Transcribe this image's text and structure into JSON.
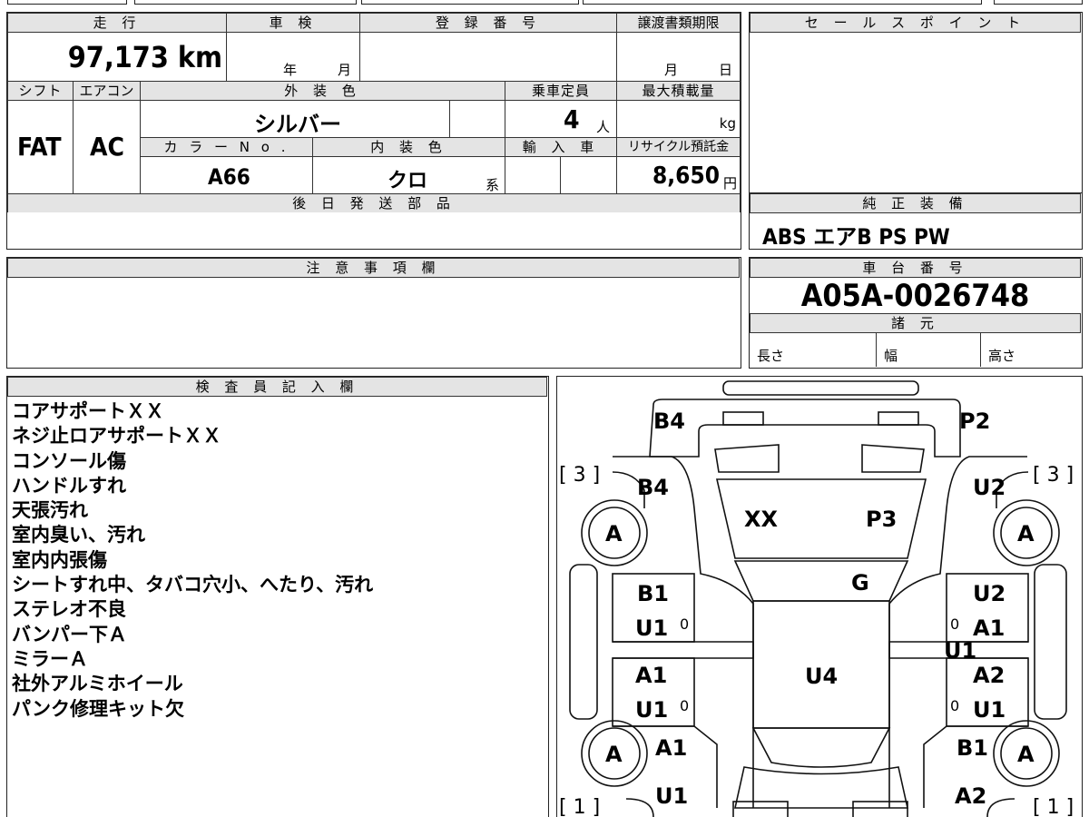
{
  "vehicle_info": {
    "mileage_label": "走 行",
    "mileage_value": "97,173 km",
    "inspection_label": "車 検",
    "inspection_year": "年",
    "inspection_month": "月",
    "registration_label": "登 録 番 号",
    "transfer_deadline_label": "譲渡書類期限",
    "transfer_month": "月",
    "transfer_day": "日",
    "shift_label": "シフト",
    "shift_value": "FAT",
    "aircon_label": "エアコン",
    "aircon_value": "AC",
    "exterior_color_label": "外 装 色",
    "exterior_color_value": "シルバー",
    "capacity_label": "乗車定員",
    "capacity_value": "4",
    "capacity_unit": "人",
    "max_load_label": "最大積載量",
    "max_load_unit": "kg",
    "color_no_label": "カ ラ ー N o .",
    "color_no_value": "A66",
    "interior_color_label": "内 装 色",
    "interior_color_value": "クロ",
    "interior_color_suffix": "系",
    "import_label": "輸 入 車",
    "recycle_label": "リサイクル預託金",
    "recycle_value": "8,650",
    "recycle_unit": "円",
    "later_parts_label": "後 日 発 送 部 品"
  },
  "sales_point": {
    "label": "セ ー ル ス ポ イ ン ト"
  },
  "standard_equipment": {
    "label": "純 正 装 備",
    "value": "ABS エアB PS PW"
  },
  "notes": {
    "label": "注 意 事 項 欄"
  },
  "chassis": {
    "label": "車 台 番 号",
    "value": "A05A-0026748",
    "specs_label": "諸 元",
    "length_label": "長さ",
    "width_label": "幅",
    "height_label": "高さ"
  },
  "inspector": {
    "label": "検 査 員 記 入 欄",
    "remarks": [
      "コアサポートＸＸ",
      "ネジ止ロアサポートＸＸ",
      "コンソール傷",
      "ハンドルすれ",
      "天張汚れ",
      "室内臭い、汚れ",
      "室内内張傷",
      "シートすれ中、タバコ穴小、へたり、汚れ",
      "ステレオ不良",
      "バンパー下Ａ",
      "ミラーＡ",
      "社外アルミホイール",
      "パンク修理キット欠"
    ]
  },
  "diagram": {
    "marks": [
      {
        "text": "B4"
      },
      {
        "text": "P2"
      },
      {
        "text": "B4"
      },
      {
        "text": "U2"
      },
      {
        "text": "XX"
      },
      {
        "text": "P3"
      },
      {
        "text": "G"
      },
      {
        "text": "B1"
      },
      {
        "text": "U1"
      },
      {
        "text": "U2"
      },
      {
        "text": "A1"
      },
      {
        "text": "U1"
      },
      {
        "text": "A1"
      },
      {
        "text": "U4"
      },
      {
        "text": "A2"
      },
      {
        "text": "U1"
      },
      {
        "text": "U1"
      },
      {
        "text": "A1"
      },
      {
        "text": "B1"
      },
      {
        "text": "U1"
      },
      {
        "text": "A2"
      }
    ],
    "wheel_label": "A",
    "tire_left_top": "[ 3 ]",
    "tire_right_top": "[ 3 ]",
    "tire_left_bottom": "[ 1 ]",
    "tire_right_bottom": "[ 1 ]",
    "zero": "0"
  }
}
